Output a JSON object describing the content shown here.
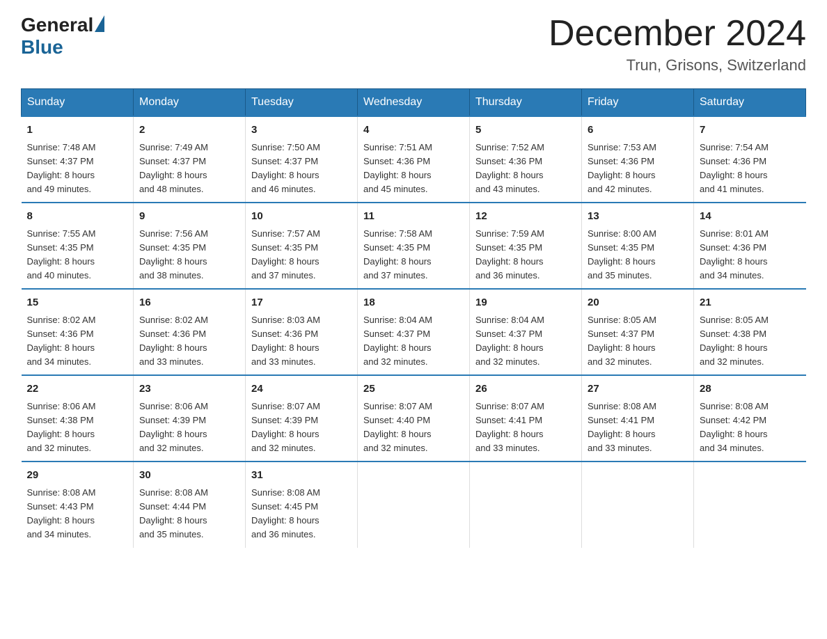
{
  "logo": {
    "general": "General",
    "blue": "Blue"
  },
  "title": "December 2024",
  "location": "Trun, Grisons, Switzerland",
  "days_of_week": [
    "Sunday",
    "Monday",
    "Tuesday",
    "Wednesday",
    "Thursday",
    "Friday",
    "Saturday"
  ],
  "weeks": [
    [
      {
        "day": "1",
        "sunrise": "7:48 AM",
        "sunset": "4:37 PM",
        "daylight": "8 hours and 49 minutes."
      },
      {
        "day": "2",
        "sunrise": "7:49 AM",
        "sunset": "4:37 PM",
        "daylight": "8 hours and 48 minutes."
      },
      {
        "day": "3",
        "sunrise": "7:50 AM",
        "sunset": "4:37 PM",
        "daylight": "8 hours and 46 minutes."
      },
      {
        "day": "4",
        "sunrise": "7:51 AM",
        "sunset": "4:36 PM",
        "daylight": "8 hours and 45 minutes."
      },
      {
        "day": "5",
        "sunrise": "7:52 AM",
        "sunset": "4:36 PM",
        "daylight": "8 hours and 43 minutes."
      },
      {
        "day": "6",
        "sunrise": "7:53 AM",
        "sunset": "4:36 PM",
        "daylight": "8 hours and 42 minutes."
      },
      {
        "day": "7",
        "sunrise": "7:54 AM",
        "sunset": "4:36 PM",
        "daylight": "8 hours and 41 minutes."
      }
    ],
    [
      {
        "day": "8",
        "sunrise": "7:55 AM",
        "sunset": "4:35 PM",
        "daylight": "8 hours and 40 minutes."
      },
      {
        "day": "9",
        "sunrise": "7:56 AM",
        "sunset": "4:35 PM",
        "daylight": "8 hours and 38 minutes."
      },
      {
        "day": "10",
        "sunrise": "7:57 AM",
        "sunset": "4:35 PM",
        "daylight": "8 hours and 37 minutes."
      },
      {
        "day": "11",
        "sunrise": "7:58 AM",
        "sunset": "4:35 PM",
        "daylight": "8 hours and 37 minutes."
      },
      {
        "day": "12",
        "sunrise": "7:59 AM",
        "sunset": "4:35 PM",
        "daylight": "8 hours and 36 minutes."
      },
      {
        "day": "13",
        "sunrise": "8:00 AM",
        "sunset": "4:35 PM",
        "daylight": "8 hours and 35 minutes."
      },
      {
        "day": "14",
        "sunrise": "8:01 AM",
        "sunset": "4:36 PM",
        "daylight": "8 hours and 34 minutes."
      }
    ],
    [
      {
        "day": "15",
        "sunrise": "8:02 AM",
        "sunset": "4:36 PM",
        "daylight": "8 hours and 34 minutes."
      },
      {
        "day": "16",
        "sunrise": "8:02 AM",
        "sunset": "4:36 PM",
        "daylight": "8 hours and 33 minutes."
      },
      {
        "day": "17",
        "sunrise": "8:03 AM",
        "sunset": "4:36 PM",
        "daylight": "8 hours and 33 minutes."
      },
      {
        "day": "18",
        "sunrise": "8:04 AM",
        "sunset": "4:37 PM",
        "daylight": "8 hours and 32 minutes."
      },
      {
        "day": "19",
        "sunrise": "8:04 AM",
        "sunset": "4:37 PM",
        "daylight": "8 hours and 32 minutes."
      },
      {
        "day": "20",
        "sunrise": "8:05 AM",
        "sunset": "4:37 PM",
        "daylight": "8 hours and 32 minutes."
      },
      {
        "day": "21",
        "sunrise": "8:05 AM",
        "sunset": "4:38 PM",
        "daylight": "8 hours and 32 minutes."
      }
    ],
    [
      {
        "day": "22",
        "sunrise": "8:06 AM",
        "sunset": "4:38 PM",
        "daylight": "8 hours and 32 minutes."
      },
      {
        "day": "23",
        "sunrise": "8:06 AM",
        "sunset": "4:39 PM",
        "daylight": "8 hours and 32 minutes."
      },
      {
        "day": "24",
        "sunrise": "8:07 AM",
        "sunset": "4:39 PM",
        "daylight": "8 hours and 32 minutes."
      },
      {
        "day": "25",
        "sunrise": "8:07 AM",
        "sunset": "4:40 PM",
        "daylight": "8 hours and 32 minutes."
      },
      {
        "day": "26",
        "sunrise": "8:07 AM",
        "sunset": "4:41 PM",
        "daylight": "8 hours and 33 minutes."
      },
      {
        "day": "27",
        "sunrise": "8:08 AM",
        "sunset": "4:41 PM",
        "daylight": "8 hours and 33 minutes."
      },
      {
        "day": "28",
        "sunrise": "8:08 AM",
        "sunset": "4:42 PM",
        "daylight": "8 hours and 34 minutes."
      }
    ],
    [
      {
        "day": "29",
        "sunrise": "8:08 AM",
        "sunset": "4:43 PM",
        "daylight": "8 hours and 34 minutes."
      },
      {
        "day": "30",
        "sunrise": "8:08 AM",
        "sunset": "4:44 PM",
        "daylight": "8 hours and 35 minutes."
      },
      {
        "day": "31",
        "sunrise": "8:08 AM",
        "sunset": "4:45 PM",
        "daylight": "8 hours and 36 minutes."
      },
      null,
      null,
      null,
      null
    ]
  ],
  "labels": {
    "sunrise": "Sunrise:",
    "sunset": "Sunset:",
    "daylight": "Daylight:"
  }
}
